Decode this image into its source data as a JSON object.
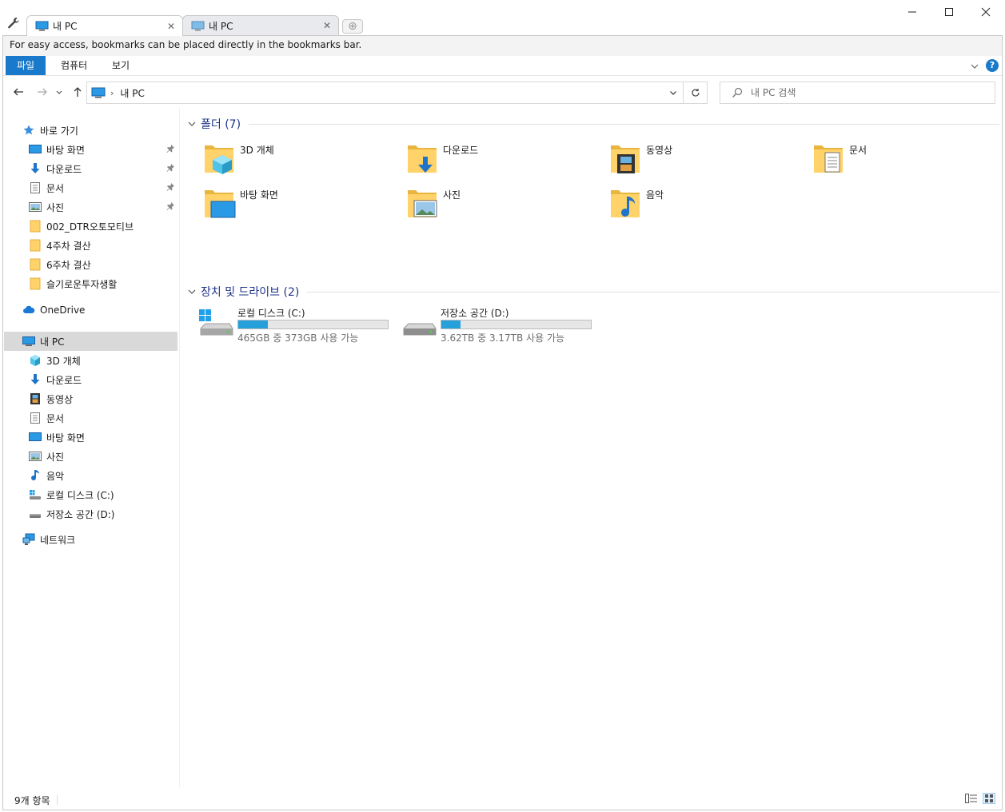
{
  "tabs": [
    {
      "label": "내 PC",
      "active": true
    },
    {
      "label": "내 PC",
      "active": false
    }
  ],
  "bookmark_hint": "For easy access, bookmarks can be placed directly in the bookmarks bar.",
  "ribbon": {
    "file": "파일",
    "computer": "컴퓨터",
    "view": "보기",
    "help": "?"
  },
  "address": {
    "path": "내 PC",
    "search_placeholder": "내 PC 검색"
  },
  "sidebar": {
    "quick_access": "바로 가기",
    "quick_items": [
      "바탕 화면",
      "다운로드",
      "문서",
      "사진",
      "002_DTR오토모티브",
      "4주차 결산",
      "6주차 결산",
      "슬기로운투자생활"
    ],
    "onedrive": "OneDrive",
    "this_pc": "내 PC",
    "pc_items": [
      "3D 개체",
      "다운로드",
      "동영상",
      "문서",
      "바탕 화면",
      "사진",
      "음악",
      "로컬 디스크 (C:)",
      "저장소 공간 (D:)"
    ],
    "network": "네트워크"
  },
  "folders_group": "폴더 (7)",
  "folders": [
    "3D 개체",
    "다운로드",
    "동영상",
    "문서",
    "바탕 화면",
    "사진",
    "음악"
  ],
  "drives_group": "장치 및 드라이브 (2)",
  "drives": [
    {
      "name": "로컬 디스크 (C:)",
      "free_text": "465GB 중 373GB 사용 가능",
      "used_fraction": 0.2
    },
    {
      "name": "저장소 공간 (D:)",
      "free_text": "3.62TB 중 3.17TB 사용 가능",
      "used_fraction": 0.13
    }
  ],
  "status": "9개 항목",
  "colors": {
    "accent": "#1979ca",
    "folder": "#ffd26a",
    "drive_bar": "#26a0da"
  }
}
